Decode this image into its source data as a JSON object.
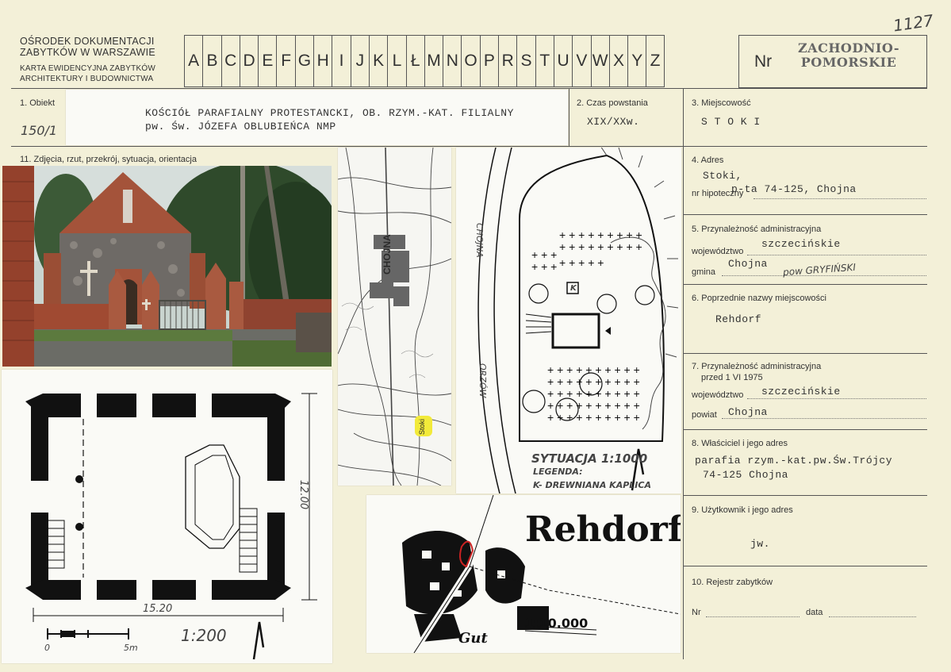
{
  "header": {
    "org_line1": "OŚRODEK DOKUMENTACJI",
    "org_line2": "ZABYTKÓW W WARSZAWIE",
    "sub_line1": "KARTA EWIDENCYJNA ZABYTKÓW",
    "sub_line2": "ARCHITEKTURY I BUDOWNICTWA",
    "letters": [
      "A",
      "B",
      "C",
      "D",
      "E",
      "F",
      "G",
      "H",
      "I",
      "J",
      "K",
      "L",
      "Ł",
      "M",
      "N",
      "O",
      "P",
      "R",
      "S",
      "T",
      "U",
      "V",
      "W",
      "X",
      "Y",
      "Z"
    ],
    "nr_label": "Nr",
    "stamp_line1": "ZACHODNIO-",
    "stamp_line2": "POMORSKIE",
    "corner_number": "1127"
  },
  "fields": {
    "obiekt": {
      "label": "1. Obiekt",
      "value_line1": "KOŚCIÓŁ PARAFIALNY PROTESTANCKI, OB. RZYM.-KAT. FILIALNY",
      "value_line2": "pw. Św. JÓZEFA OBLUBIEŃCA NMP",
      "hand_number": "150/1"
    },
    "czas": {
      "label": "2. Czas powstania",
      "value": "XIX/XXw."
    },
    "miejscowosc": {
      "label": "3. Miejscowość",
      "value": "S T O K I"
    },
    "adres": {
      "label": "4. Adres",
      "value_line1": "Stoki,",
      "value_line2": "p-ta 74-125, Chojna",
      "sub_label": "nr hipoteczny"
    },
    "przynaleznosc": {
      "label": "5. Przynależność administracyjna",
      "woj_label": "województwo",
      "woj_value": "szczecińskie",
      "gmina_label": "gmina",
      "gmina_value": "Chojna",
      "gmina_hand": "pow GRYFIŃSKI"
    },
    "poprzednie": {
      "label": "6. Poprzednie nazwy miejscowości",
      "value": "Rehdorf"
    },
    "przynaleznosc_przed": {
      "label": "7. Przynależność administracyjna",
      "label2": "przed 1 VI 1975",
      "woj_label": "województwo",
      "woj_value": "szczecińskie",
      "powiat_label": "powiat",
      "powiat_value": "Chojna"
    },
    "wlasciciel": {
      "label": "8. Właściciel i jego adres",
      "value_line1": "parafia rzym.-kat.pw.Św.Trójcy",
      "value_line2": "74-125 Chojna"
    },
    "uzytkownik": {
      "label": "9. Użytkownik i jego adres",
      "value": "jw."
    },
    "rejestr": {
      "label": "10. Rejestr zabytków",
      "nr_label": "Nr",
      "data_label": "data"
    }
  },
  "images": {
    "section_label": "11. Zdjęcia, rzut, przekrój, sytuacja, orientacja",
    "plan_width": "15.20",
    "plan_depth": "12.00",
    "plan_scale": "1:200",
    "scale_0": "0",
    "scale_5": "5m",
    "map_town": "CHOJNA",
    "map_marker": "Stoki",
    "situation_title": "SYTUACJA 1:1000",
    "situation_legend": "LEGENDA:",
    "situation_key": "K- DREWNIANA KAPLICA",
    "situation_road1": "CHOJNA",
    "situation_road2": "ORZÓW",
    "situation_k": "K",
    "old_map_name": "Rehdorf",
    "old_map_scale": "1:10.000",
    "old_map_gut": "Gut"
  },
  "colors": {
    "paper": "#f3f0d8",
    "brick": "#a2452f",
    "ink": "#222222",
    "highlight": "#f2ea3a",
    "red_mark": "#cc2222"
  }
}
